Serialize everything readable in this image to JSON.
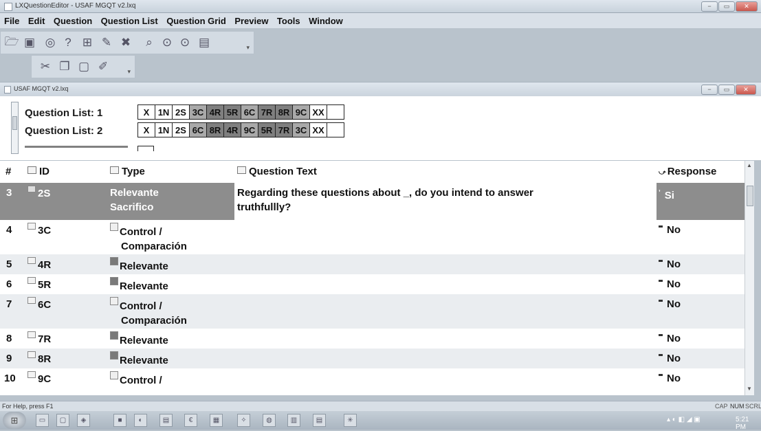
{
  "window": {
    "title": "LXQuestionEditor - USAF MGQT v2.lxq"
  },
  "window_controls": {
    "minimize": "−",
    "restore": "▭",
    "close": "✕"
  },
  "menu": [
    "File",
    "Edit",
    "Question",
    "Question List",
    "Question Grid",
    "Preview",
    "Tools",
    "Window"
  ],
  "toolbar1_icons": [
    "open-folder-icon",
    "save-icon",
    "find-icon",
    "question-help-icon",
    "add-question-icon",
    "edit-icon",
    "delete-icon",
    "search-icon",
    "move-up-icon",
    "move-down-icon",
    "chart-icon"
  ],
  "toolbar2_icons": [
    "cut-icon",
    "copy-icon",
    "paste-icon",
    "clear-icon"
  ],
  "document": {
    "title": "USAF MGQT v2.lxq"
  },
  "question_lists": [
    {
      "label": "Question List: 1",
      "cells": [
        "X",
        "1N",
        "2S",
        "3C",
        "4R",
        "5R",
        "6C",
        "7R",
        "8R",
        "9C",
        "XX",
        ""
      ]
    },
    {
      "label": "Question List: 2",
      "cells": [
        "X",
        "1N",
        "2S",
        "6C",
        "8R",
        "4R",
        "9C",
        "5R",
        "7R",
        "3C",
        "XX",
        ""
      ]
    }
  ],
  "table": {
    "columns": {
      "num": "#",
      "id": "ID",
      "type": "Type",
      "question_text": "Question Text",
      "response": "Response"
    },
    "rows": [
      {
        "num": "3",
        "id": "2S",
        "type_line1": "Relevante",
        "type_line2": "Sacrifico",
        "text_line1": "Regarding these questions about _, do you intend to answer",
        "text_line2": "truthfullly?",
        "response": "Si"
      },
      {
        "num": "4",
        "id": "3C",
        "type_line1": "Control /",
        "type_line2": "Comparación",
        "text_line1": "",
        "text_line2": "",
        "response": "No"
      },
      {
        "num": "5",
        "id": "4R",
        "type_line1": "Relevante",
        "type_line2": "",
        "text_line1": "",
        "text_line2": "",
        "response": "No"
      },
      {
        "num": "6",
        "id": "5R",
        "type_line1": "Relevante",
        "type_line2": "",
        "text_line1": "",
        "text_line2": "",
        "response": "No"
      },
      {
        "num": "7",
        "id": "6C",
        "type_line1": "Control /",
        "type_line2": "Comparación",
        "text_line1": "",
        "text_line2": "",
        "response": "No"
      },
      {
        "num": "8",
        "id": "7R",
        "type_line1": "Relevante",
        "type_line2": "",
        "text_line1": "",
        "text_line2": "",
        "response": "No"
      },
      {
        "num": "9",
        "id": "8R",
        "type_line1": "Relevante",
        "type_line2": "",
        "text_line1": "",
        "text_line2": "",
        "response": "No"
      },
      {
        "num": "10",
        "id": "9C",
        "type_line1": "Control /",
        "type_line2": "",
        "text_line1": "",
        "text_line2": "",
        "response": "No"
      }
    ]
  },
  "status": {
    "help": "For Help, press F1",
    "cap": "CAP",
    "num": "NUM",
    "scrl": "SCRL"
  },
  "taskbar": {
    "clock": "5:21 PM"
  },
  "colors": {
    "selected_row": "#8d8d8d",
    "dark_cell": "#7f7f7f",
    "mid_cell": "#a9a9a9",
    "window_bg": "#b9c3cc"
  }
}
